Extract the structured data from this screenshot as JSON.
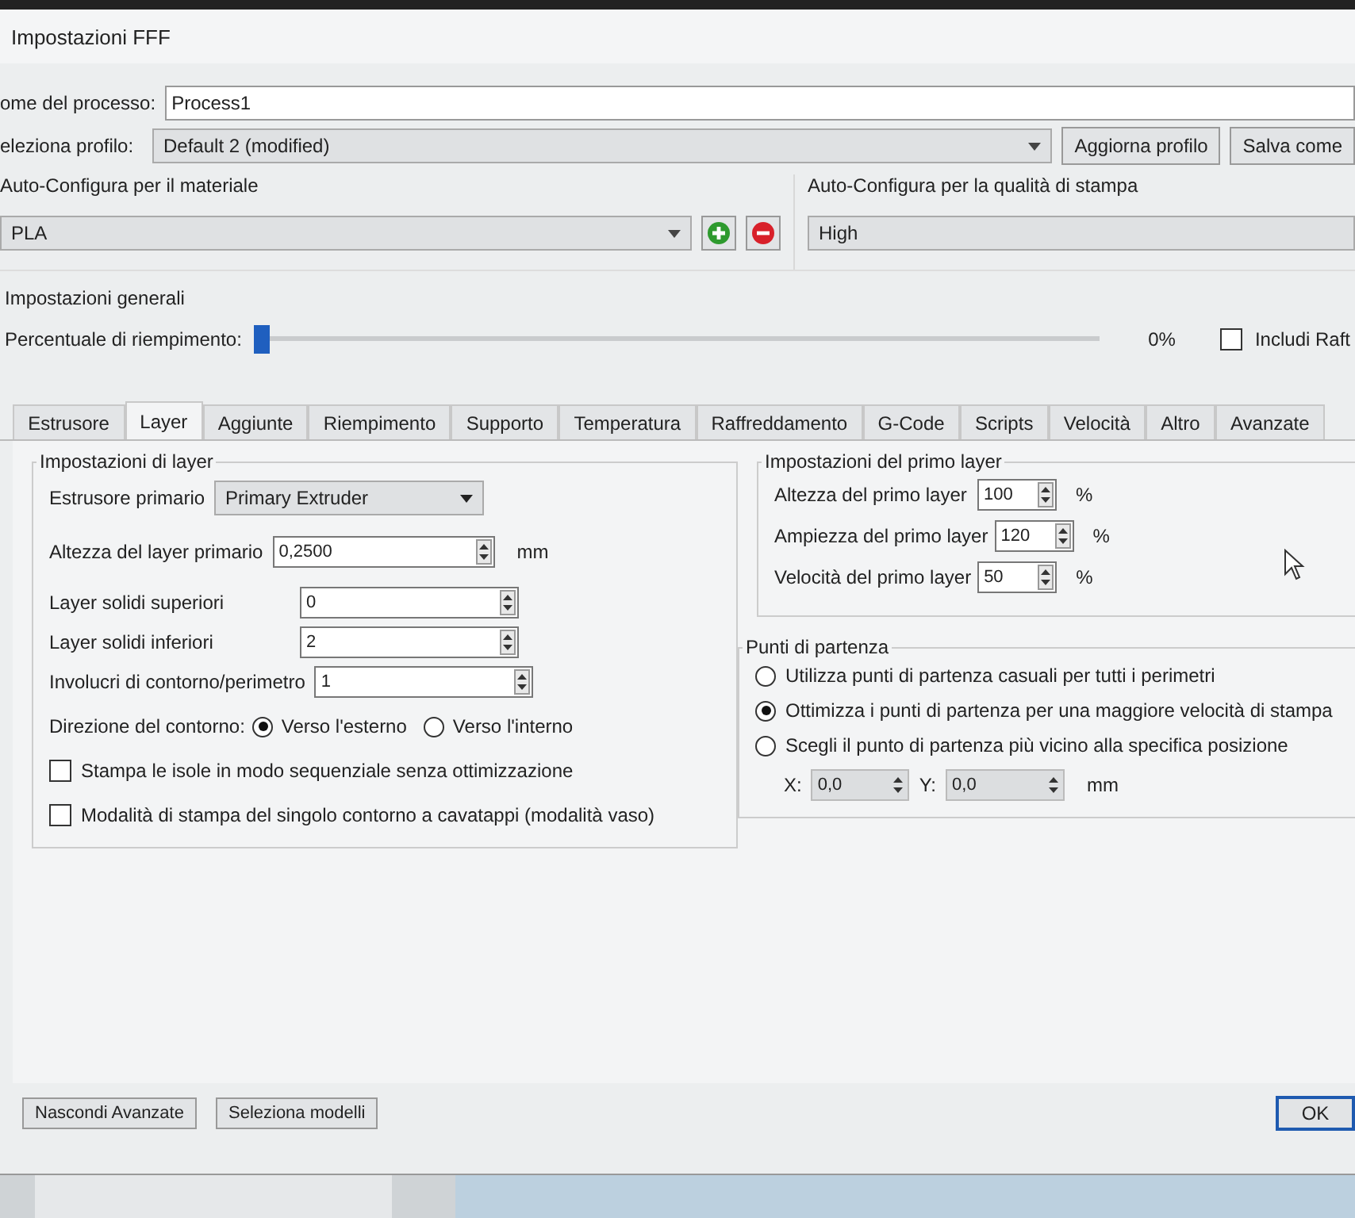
{
  "window": {
    "title": "Impostazioni FFF"
  },
  "process_name": {
    "label": "ome del processo:",
    "value": "Process1"
  },
  "profile": {
    "label": "eleziona profilo:",
    "value": "Default 2 (modified)",
    "buttons": [
      "Aggiorna profilo",
      "Salva come"
    ]
  },
  "material": {
    "title": "Auto-Configura per il materiale",
    "value": "PLA"
  },
  "quality": {
    "title": "Auto-Configura per la qualità di stampa",
    "value": "High"
  },
  "general": {
    "title": "Impostazioni generali",
    "infill_label": "Percentuale di riempimento:",
    "level": 0,
    "reading": "0%",
    "raft": {
      "label": "Includi Raft",
      "checked": false
    }
  },
  "tabs": [
    {
      "label": "Estrusore",
      "selected": false
    },
    {
      "label": "Layer",
      "selected": true
    },
    {
      "label": "Aggiunte",
      "selected": false
    },
    {
      "label": "Riempimento",
      "selected": false
    },
    {
      "label": "Supporto",
      "selected": false
    },
    {
      "label": "Temperatura",
      "selected": false
    },
    {
      "label": "Raffreddamento",
      "selected": false
    },
    {
      "label": "G-Code",
      "selected": false
    },
    {
      "label": "Scripts",
      "selected": false
    },
    {
      "label": "Velocità",
      "selected": false
    },
    {
      "label": "Altro",
      "selected": false
    },
    {
      "label": "Avanzate",
      "selected": false
    }
  ],
  "layer_group": {
    "title": "Impostazioni di layer",
    "extruder": {
      "label": "Estrusore primario",
      "value": "Primary Extruder"
    },
    "height": {
      "label": "Altezza del layer primario",
      "value": "0,2500",
      "unit": "mm"
    },
    "spins": [
      {
        "label": "Layer solidi superiori",
        "value": "0"
      },
      {
        "label": "Layer solidi inferiori",
        "value": "2"
      },
      {
        "label": "Involucri di contorno/perimetro",
        "value": "1"
      }
    ],
    "direction": {
      "label": "Direzione del contorno:",
      "options": [
        {
          "label": "Verso l'esterno",
          "selected": true
        },
        {
          "label": "Verso l'interno",
          "selected": false
        }
      ]
    },
    "checks": [
      {
        "label": "Stampa le isole in modo sequenziale senza ottimizzazione",
        "checked": false
      },
      {
        "label": "Modalità di stampa del singolo contorno a cavatappi (modalità vaso)",
        "checked": false
      }
    ]
  },
  "first_layer": {
    "title": "Impostazioni del primo layer",
    "rows": [
      {
        "label": "Altezza del primo layer",
        "value": "100",
        "unit": "%"
      },
      {
        "label": "Ampiezza del primo layer",
        "value": "120",
        "unit": "%"
      },
      {
        "label": "Velocità del primo layer",
        "value": "50",
        "unit": "%"
      }
    ]
  },
  "start_points": {
    "title": "Punti di partenza",
    "options": [
      {
        "label": "Utilizza punti di partenza casuali per tutti i perimetri",
        "selected": false
      },
      {
        "label": "Ottimizza i punti di partenza per una maggiore velocità di stampa",
        "selected": true
      },
      {
        "label": "Scegli il punto di partenza più vicino alla specifica posizione",
        "selected": false
      }
    ],
    "x": {
      "label": "X:",
      "value": "0,0"
    },
    "y": {
      "label": "Y:",
      "value": "0,0"
    },
    "unit": "mm"
  },
  "footer": {
    "buttons": [
      "Nascondi Avanzate",
      "Seleziona modelli"
    ],
    "ok": "OK"
  }
}
